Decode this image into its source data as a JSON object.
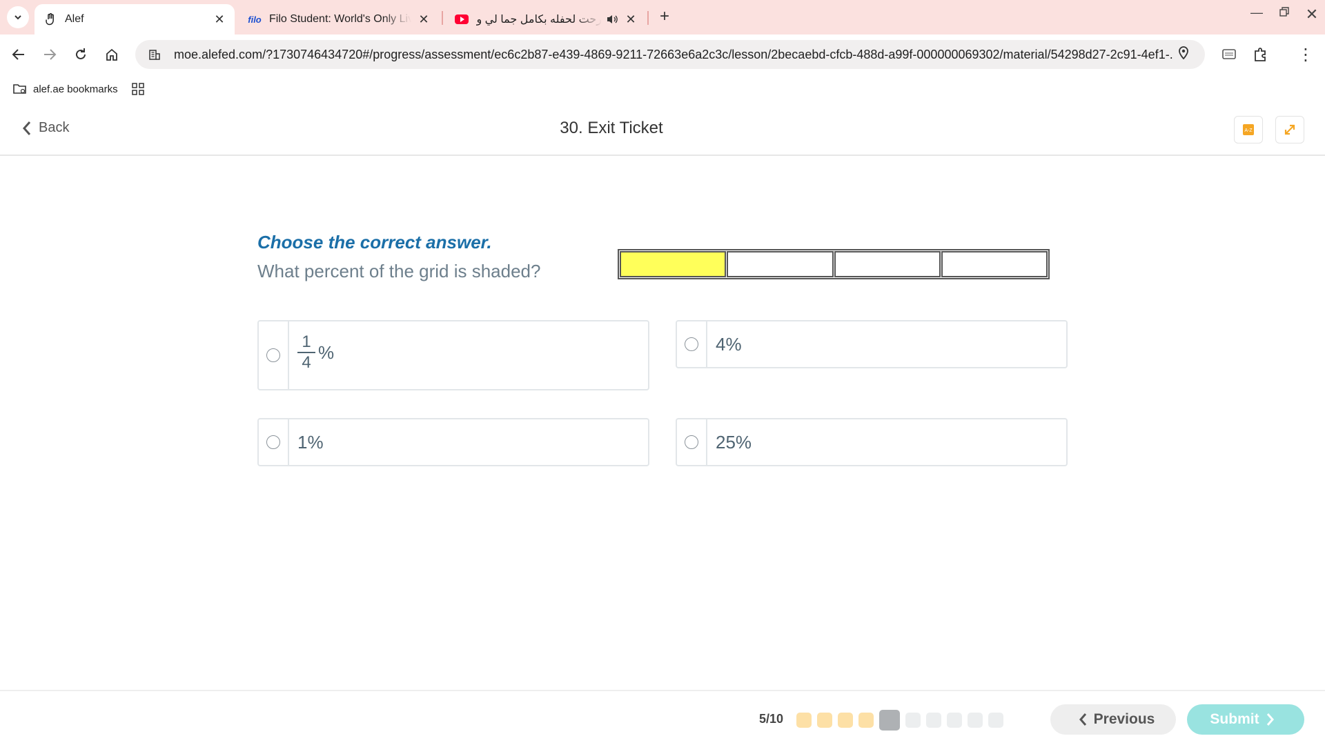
{
  "browser": {
    "tabs": [
      {
        "title": "Alef",
        "active": true,
        "favicon": "hand-icon"
      },
      {
        "title": "Filo Student: World's Only Live Instant Tutoring Platform",
        "favicon_text": "filo"
      },
      {
        "title": "رحت لحفله بكامل جما لي ولماذا",
        "favicon": "youtube-icon",
        "audio": true
      }
    ],
    "url": "moe.alefed.com/?1730746434720#/progress/assessment/ec6c2b87-e439-4869-9211-72663e6a2c3c/lesson/2becaebd-cfcb-488d-a99f-000000069302/material/54298d27-2c91-4ef1-...",
    "bookmarks": [
      {
        "label": "alef.ae bookmarks"
      }
    ]
  },
  "header": {
    "back_label": "Back",
    "title": "30. Exit Ticket",
    "accent_color": "#f5a623"
  },
  "question": {
    "instruction": "Choose the correct answer.",
    "prompt": "What percent of the grid is shaded?",
    "grid": {
      "columns": 4,
      "shaded": 1,
      "shaded_color": "#ffff5a"
    },
    "options": [
      {
        "fraction_num": "1",
        "fraction_den": "4",
        "suffix": "%"
      },
      {
        "label": "4%"
      },
      {
        "label": "1%"
      },
      {
        "label": "25%"
      }
    ]
  },
  "footer": {
    "progress_label": "5/10",
    "current": 5,
    "total": 10,
    "previous_label": "Previous",
    "submit_label": "Submit",
    "submit_color": "#99e3e0"
  }
}
